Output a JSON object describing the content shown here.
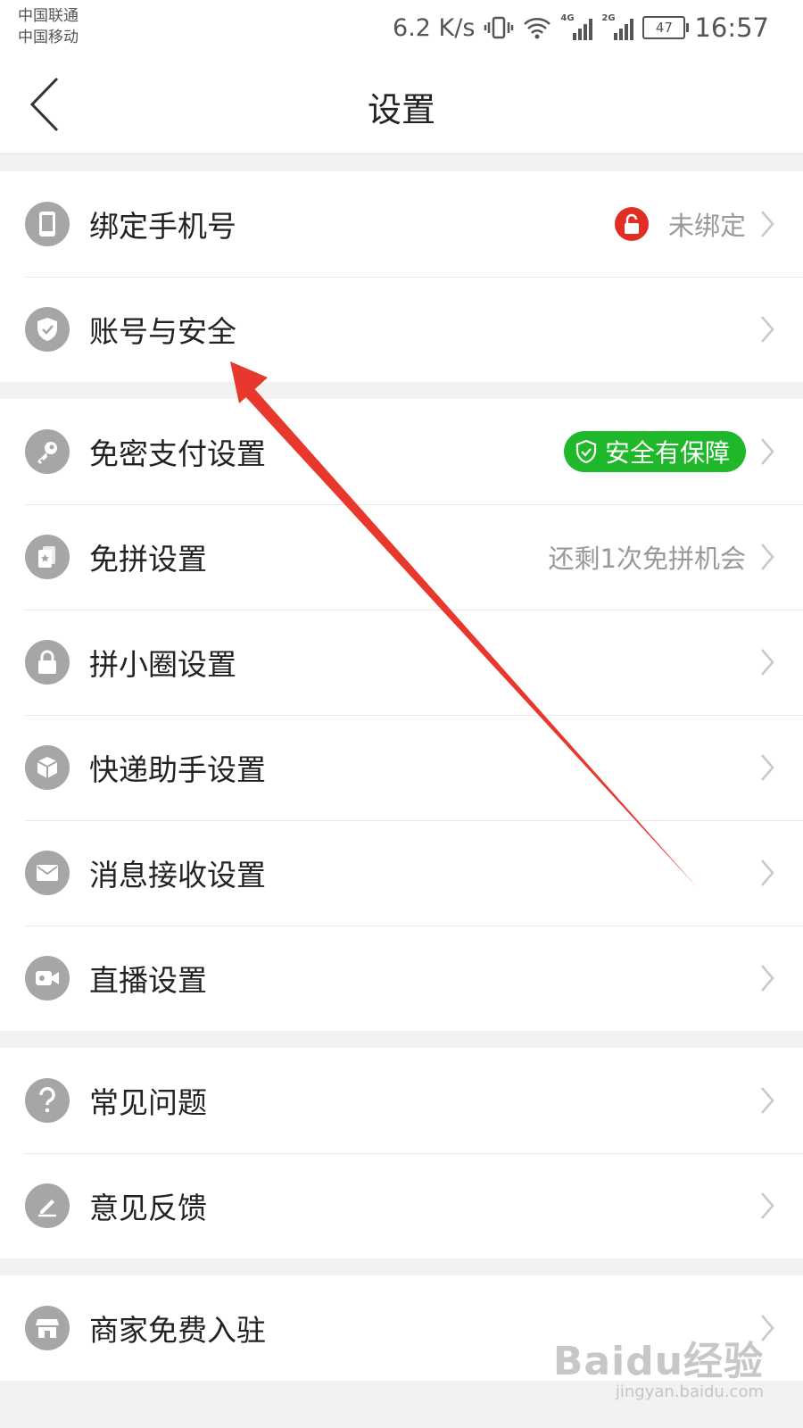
{
  "status_bar": {
    "carrier_1": "中国联通",
    "carrier_2": "中国移动",
    "net_speed": "6.2 K/s",
    "signal_1_label": "4G",
    "signal_2_label": "2G",
    "battery": "47",
    "time": "16:57"
  },
  "header": {
    "title": "设置"
  },
  "groups": [
    {
      "items": [
        {
          "label": "绑定手机号",
          "value": "未绑定",
          "icon": "phone-icon"
        },
        {
          "label": "账号与安全",
          "icon": "shield-icon"
        }
      ]
    },
    {
      "items": [
        {
          "label": "免密支付设置",
          "badge": "安全有保障",
          "icon": "key-icon"
        },
        {
          "label": "免拼设置",
          "value": "还剩1次免拼机会",
          "icon": "card-icon"
        },
        {
          "label": "拼小圈设置",
          "icon": "lock-icon"
        },
        {
          "label": "快递助手设置",
          "icon": "box-icon"
        },
        {
          "label": "消息接收设置",
          "icon": "mail-icon"
        },
        {
          "label": "直播设置",
          "icon": "video-icon"
        }
      ]
    },
    {
      "items": [
        {
          "label": "常见问题",
          "icon": "question-icon"
        },
        {
          "label": "意见反馈",
          "icon": "pencil-icon"
        }
      ]
    },
    {
      "items": [
        {
          "label": "商家免费入驻",
          "icon": "store-icon"
        }
      ]
    }
  ],
  "watermark": {
    "main": "Baidu经验",
    "sub": "jingyan.baidu.com"
  },
  "colors": {
    "accent_red": "#e02e24",
    "badge_green": "#1fb82b",
    "icon_gray": "#a6a6a6",
    "annotation_arrow": "#e8372c"
  }
}
